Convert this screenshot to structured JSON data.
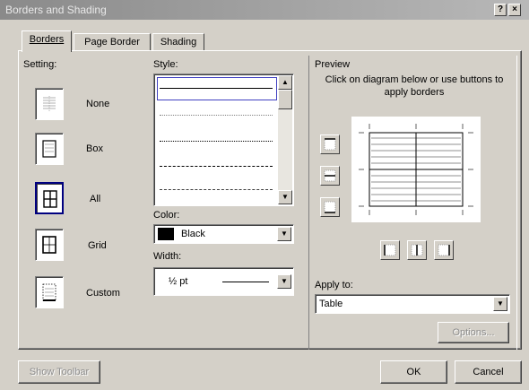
{
  "window": {
    "title": "Borders and Shading",
    "help_label": "?",
    "close_label": "×"
  },
  "tabs": [
    {
      "label": "Borders",
      "active": true
    },
    {
      "label": "Page Border",
      "active": false
    },
    {
      "label": "Shading",
      "active": false
    }
  ],
  "setting": {
    "heading": "Setting:",
    "options": [
      {
        "label": "None",
        "selected": false
      },
      {
        "label": "Box",
        "selected": false
      },
      {
        "label": "All",
        "selected": true
      },
      {
        "label": "Grid",
        "selected": false
      },
      {
        "label": "Custom",
        "selected": false
      }
    ]
  },
  "style": {
    "heading": "Style:",
    "options": [
      "solid",
      "dotted",
      "dense-dotted",
      "dashed",
      "long-dashed"
    ],
    "selected": "solid"
  },
  "color": {
    "heading": "Color:",
    "value": "Black",
    "swatch": "#000000"
  },
  "width": {
    "heading": "Width:",
    "value": "½ pt"
  },
  "preview": {
    "heading": "Preview",
    "instruction": "Click on diagram below or use buttons to apply borders"
  },
  "apply_to": {
    "heading": "Apply to:",
    "value": "Table"
  },
  "buttons": {
    "options": "Options...",
    "show_toolbar": "Show Toolbar",
    "ok": "OK",
    "cancel": "Cancel"
  },
  "colors": {
    "selection": "#000080",
    "face": "#d4d0c8"
  }
}
